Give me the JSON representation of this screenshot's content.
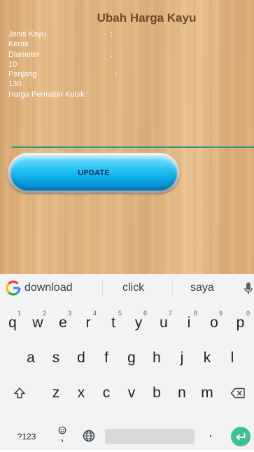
{
  "app": {
    "title": "Ubah Harga Kayu",
    "fields": [
      {
        "label": "Jenis Kayu",
        "colon": ":"
      },
      {
        "value": "Keras"
      },
      {
        "label": "Diameter",
        "colon": ":"
      },
      {
        "value": "10"
      },
      {
        "label": "Panjang",
        "colon": ":"
      },
      {
        "value": "130"
      },
      {
        "label": "Harga Permater Kubik :"
      }
    ],
    "update_label": "UPDATE"
  },
  "keyboard": {
    "suggestions": [
      "download",
      "click",
      "saya"
    ],
    "row1": [
      {
        "key": "q",
        "sup": "1"
      },
      {
        "key": "w",
        "sup": "2"
      },
      {
        "key": "e",
        "sup": "3"
      },
      {
        "key": "r",
        "sup": "4"
      },
      {
        "key": "t",
        "sup": "5"
      },
      {
        "key": "y",
        "sup": "6"
      },
      {
        "key": "u",
        "sup": "7"
      },
      {
        "key": "i",
        "sup": "8"
      },
      {
        "key": "o",
        "sup": "9"
      },
      {
        "key": "p",
        "sup": "0"
      }
    ],
    "row2": [
      "a",
      "s",
      "d",
      "f",
      "g",
      "h",
      "j",
      "k",
      "l"
    ],
    "row3": [
      "z",
      "x",
      "c",
      "v",
      "b",
      "n",
      "m"
    ],
    "symbols_label": "?123",
    "comma": ",",
    "period": ".",
    "icons": {
      "google": "google-g-icon",
      "mic": "microphone-icon",
      "shift": "shift-icon",
      "backspace": "backspace-icon",
      "emoji": "emoji-icon",
      "globe": "globe-icon",
      "enter": "enter-icon"
    },
    "enter_color": "#3fbf96"
  }
}
